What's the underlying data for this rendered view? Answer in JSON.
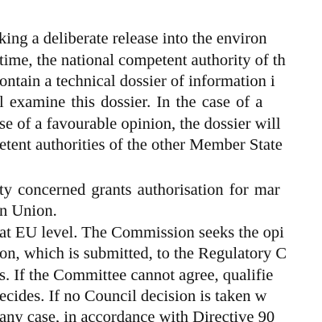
{
  "paragraph1": {
    "lines": [
      "king a deliberate release into the environ",
      "time, the national competent authority of th",
      "ontain a technical dossier of information i",
      "l  examine  this  dossier.  In  the  case  of  a",
      "se of a favourable opinion, the dossier will",
      "etent authorities of the other Member State"
    ]
  },
  "paragraph2": {
    "lines": [
      "ty  concerned  grants  authorisation  for  mar",
      "n Union."
    ]
  },
  "paragraph3": {
    "lines": [
      "at EU level. The Commission seeks the opi",
      "on, which is submitted, to the Regulatory C",
      "s. If the Committee cannot agree, qualifie",
      "ecides. If no Council decision is taken w",
      "any case, in accordance with Directive 90"
    ]
  }
}
